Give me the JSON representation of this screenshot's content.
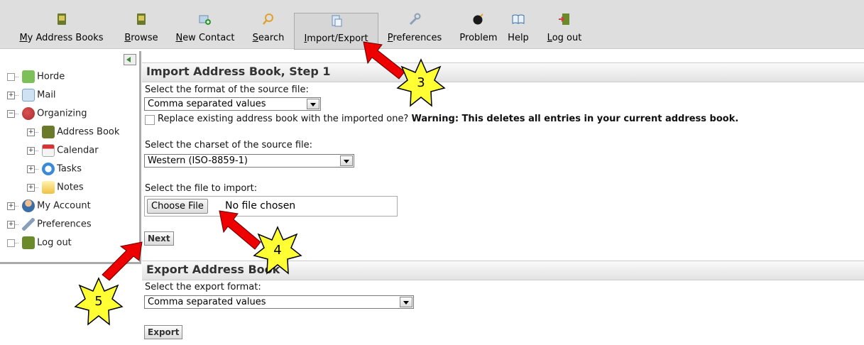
{
  "toolbar": {
    "items": [
      {
        "label_underlined": "M",
        "label_rest": "y Address Books",
        "icon": "address-book-icon"
      },
      {
        "label_underlined": "B",
        "label_rest": "rowse",
        "icon": "browse-icon"
      },
      {
        "label_underlined": "N",
        "label_rest": "ew Contact",
        "icon": "new-contact-icon"
      },
      {
        "label_underlined": "S",
        "label_rest": "earch",
        "icon": "search-icon"
      },
      {
        "label_underlined": "I",
        "label_rest": "mport/Export",
        "icon": "import-export-icon"
      },
      {
        "label_underlined": "P",
        "label_rest": "references",
        "icon": "preferences-icon"
      },
      {
        "label_underlined": "",
        "label_rest": "Problem",
        "icon": "problem-icon"
      },
      {
        "label_underlined": "",
        "label_rest": "Help",
        "icon": "help-icon"
      },
      {
        "label_underlined": "L",
        "label_rest": "og out",
        "icon": "logout-icon"
      }
    ]
  },
  "sidebar": {
    "items": [
      {
        "label": "Horde",
        "icon": "horde-icon",
        "expander": ""
      },
      {
        "label": "Mail",
        "icon": "mail-icon",
        "expander": "+"
      },
      {
        "label": "Organizing",
        "icon": "organizing-icon",
        "expander": "−"
      },
      {
        "label": "Address Book",
        "icon": "address-book-icon",
        "expander": "+"
      },
      {
        "label": "Calendar",
        "icon": "calendar-icon",
        "expander": "+"
      },
      {
        "label": "Tasks",
        "icon": "tasks-icon",
        "expander": "+"
      },
      {
        "label": "Notes",
        "icon": "notes-icon",
        "expander": "+"
      },
      {
        "label": "My Account",
        "icon": "account-icon",
        "expander": "+"
      },
      {
        "label": "Preferences",
        "icon": "preferences-icon",
        "expander": "+"
      },
      {
        "label": "Log out",
        "icon": "logout-icon",
        "expander": ""
      }
    ]
  },
  "import": {
    "title": "Import Address Book, Step 1",
    "format_label": "Select the format of the source file:",
    "format_value": "Comma separated values",
    "replace_label": "Replace existing address book with the imported one?",
    "replace_warning": "Warning: This deletes all entries in your current address book.",
    "charset_label": "Select the charset of the source file:",
    "charset_value": "Western (ISO-8859-1)",
    "file_label": "Select the file to import:",
    "choose_file": "Choose File",
    "file_status": "No file chosen",
    "next_button": "Next"
  },
  "export": {
    "title": "Export Address Book",
    "format_label": "Select the export format:",
    "format_value": "Comma separated values",
    "export_button": "Export"
  },
  "annotations": {
    "callouts": [
      {
        "number": "3"
      },
      {
        "number": "4"
      },
      {
        "number": "5"
      }
    ],
    "star_color": "#ffff33",
    "arrow_color": "#ee0000"
  }
}
